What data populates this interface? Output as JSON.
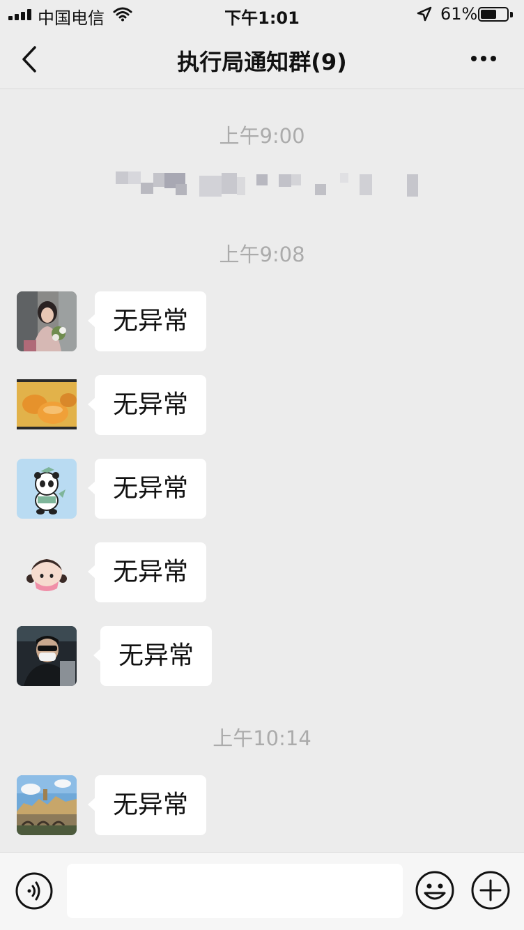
{
  "status_bar": {
    "carrier": "中国电信",
    "time": "下午1:01",
    "battery_percent": "61%",
    "battery_level": 0.61,
    "icons": [
      "signal-icon",
      "wifi-icon",
      "location-arrow-icon",
      "battery-icon"
    ]
  },
  "nav": {
    "title": "执行局通知群(9)",
    "back_icon": "chevron-left-icon",
    "more_icon": "more-dots-icon"
  },
  "chat": {
    "timestamps": [
      "上午9:00",
      "上午9:08",
      "上午10:14"
    ],
    "messages": [
      {
        "text": "无异常",
        "avatar": "photo-avatar-girl-flowers"
      },
      {
        "text": "无异常",
        "avatar": "photo-avatar-buns"
      },
      {
        "text": "无异常",
        "avatar": "cartoon-avatar-panda"
      },
      {
        "text": "无异常",
        "avatar": "cartoon-avatar-girl"
      },
      {
        "text": "无异常",
        "avatar": "photo-avatar-man-mask"
      },
      {
        "text": "无异常",
        "avatar": "photo-avatar-landscape"
      }
    ]
  },
  "input_bar": {
    "placeholder": "",
    "icons": [
      "voice-icon",
      "emoji-icon",
      "plus-icon"
    ]
  },
  "colors": {
    "background": "#ececec",
    "bubble": "#ffffff",
    "timestamp": "#ababab",
    "bar": "#ededed"
  }
}
